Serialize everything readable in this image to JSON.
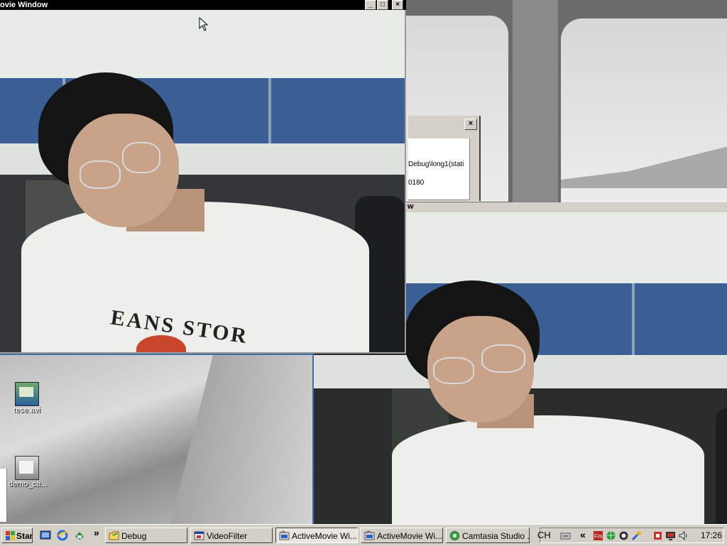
{
  "movie_window": {
    "title": "ovie Window",
    "buttons": {
      "minimize": "_",
      "maximize": "□",
      "close": "×"
    },
    "shirt_text": "EANS STOR"
  },
  "right_video": {
    "title_fragment": "w"
  },
  "dialog": {
    "close_label": "×",
    "line1": "Debug\\long1(stati",
    "line2": "0180"
  },
  "desktop_icons": [
    {
      "label": "tese.avi",
      "icon": "video-file-icon"
    },
    {
      "label": "demo_ca...",
      "icon": "video-file-icon"
    }
  ],
  "taskbar": {
    "start_label": "Start",
    "more_label": "»",
    "items": [
      {
        "label": "Debug",
        "icon": "folder-icon",
        "active": false
      },
      {
        "label": "VideoFilter",
        "icon": "app-icon",
        "active": false
      },
      {
        "label": "ActiveMovie Wi...",
        "icon": "activemovie-icon",
        "active": true
      },
      {
        "label": "ActiveMovie Wi...",
        "icon": "activemovie-icon",
        "active": false
      },
      {
        "label": "Camtasia Studio ...",
        "icon": "camtasia-icon",
        "active": false
      }
    ],
    "tray": {
      "language": "CH",
      "expand_label": "«",
      "clock": "17:26"
    }
  },
  "colors": {
    "partition_blue": "#3a5f94",
    "desktop_blue": "#3a6ea5",
    "taskbar_gray": "#d4d0c8"
  }
}
